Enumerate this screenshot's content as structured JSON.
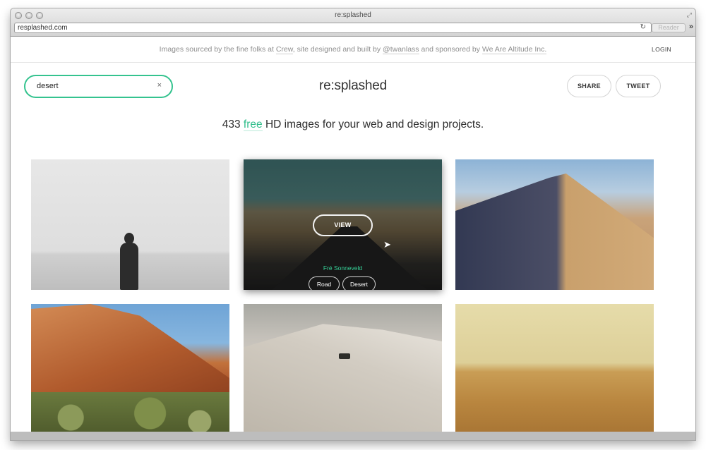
{
  "browser": {
    "window_title": "re:splashed",
    "url": "resplashed.com",
    "reader_label": "Reader",
    "more_label": "»"
  },
  "credits": {
    "prefix": "Images sourced by the fine folks at ",
    "crew": "Crew",
    "middle": ", site designed and built by ",
    "designer": "@twanlass",
    "suffix": " and sponsored by ",
    "sponsor": "We Are Altitude Inc.",
    "login": "LOGIN"
  },
  "search": {
    "value": "desert",
    "clear_glyph": "×"
  },
  "logo": {
    "bold": "re",
    "rest": ":splashed"
  },
  "actions": {
    "share": "SHARE",
    "tweet": "TWEET"
  },
  "tagline": {
    "count": "433",
    "free": "free",
    "rest": "HD images for your web and design projects."
  },
  "hovered_image": {
    "view_label": "VIEW",
    "author": "Fré Sonneveld",
    "tags": [
      "Road",
      "Desert"
    ]
  },
  "colors": {
    "accent": "#35c38f"
  },
  "icons": {
    "search_clear": "close-icon",
    "reload": "reload-icon",
    "cursor": "pointer-cursor-icon"
  }
}
